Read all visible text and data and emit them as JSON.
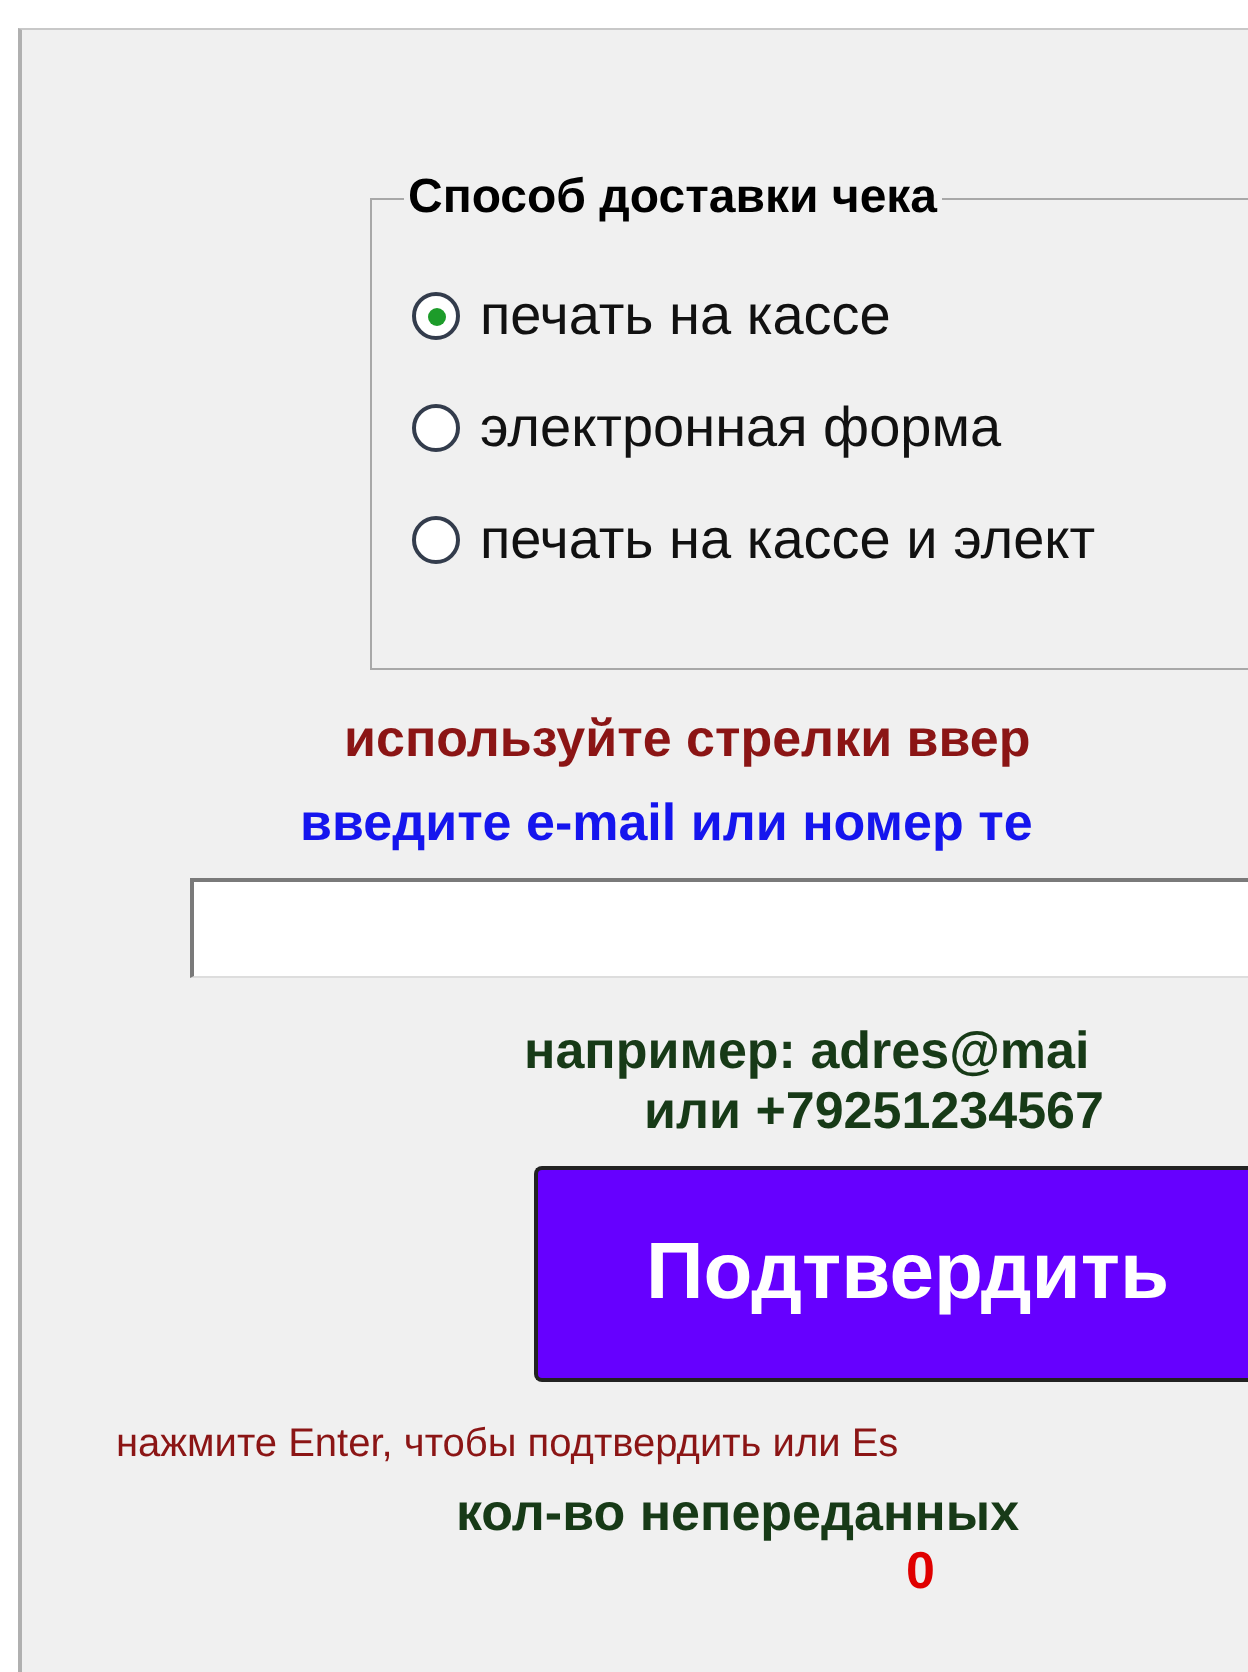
{
  "delivery_group": {
    "title": "Способ доставки чека",
    "options": [
      {
        "label": "печать на кассе",
        "selected": true
      },
      {
        "label": "электронная форма",
        "selected": false
      },
      {
        "label": "печать на кассе и элект",
        "selected": false
      }
    ]
  },
  "arrows_hint": "используйте стрелки ввер",
  "input_prompt": "введите e-mail или номер те",
  "example_lines": [
    "например: adres@mai",
    "или +79251234567"
  ],
  "confirm_button": "Подтвердить",
  "keys_hint": "нажмите Enter, чтобы подтвердить или Es",
  "unsent_label": "кол-во непереданных",
  "unsent_count": "0"
}
